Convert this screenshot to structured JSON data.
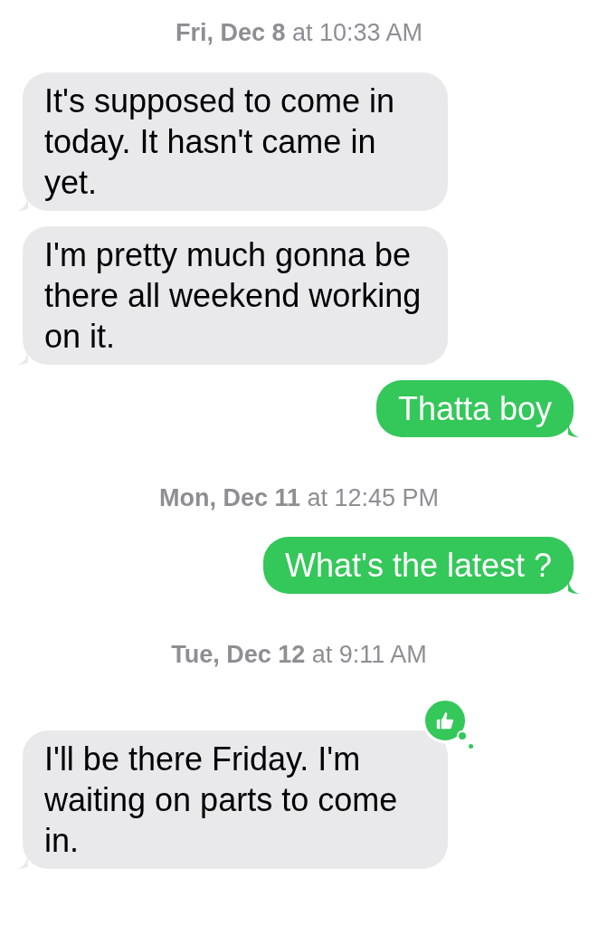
{
  "messages": [
    {
      "kind": "timestamp",
      "text": "**Fri, Dec 8** at 10:33 AM"
    },
    {
      "kind": "received",
      "text": "It's supposed to come in today. It hasn't came in yet."
    },
    {
      "kind": "received",
      "text": "I'm pretty much gonna be there all weekend working on it."
    },
    {
      "kind": "sent",
      "text": "Thatta boy"
    },
    {
      "kind": "timestamp",
      "text": "**Mon, Dec 11** at 12:45 PM"
    },
    {
      "kind": "sent",
      "text": "What's the latest ?"
    },
    {
      "kind": "timestamp",
      "text": "**Tue, Dec 12** at 9:11 AM"
    },
    {
      "kind": "received",
      "text": "I'll be there Friday. I'm waiting on parts to come in.",
      "reaction": {
        "kind": "like"
      }
    }
  ]
}
